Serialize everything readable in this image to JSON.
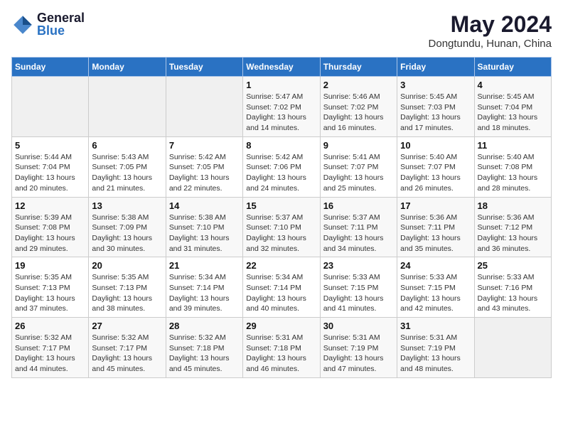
{
  "header": {
    "logo_line1": "General",
    "logo_line2": "Blue",
    "title": "May 2024",
    "subtitle": "Dongtundu, Hunan, China"
  },
  "weekdays": [
    "Sunday",
    "Monday",
    "Tuesday",
    "Wednesday",
    "Thursday",
    "Friday",
    "Saturday"
  ],
  "weeks": [
    [
      {
        "day": "",
        "info": ""
      },
      {
        "day": "",
        "info": ""
      },
      {
        "day": "",
        "info": ""
      },
      {
        "day": "1",
        "info": "Sunrise: 5:47 AM\nSunset: 7:02 PM\nDaylight: 13 hours\nand 14 minutes."
      },
      {
        "day": "2",
        "info": "Sunrise: 5:46 AM\nSunset: 7:02 PM\nDaylight: 13 hours\nand 16 minutes."
      },
      {
        "day": "3",
        "info": "Sunrise: 5:45 AM\nSunset: 7:03 PM\nDaylight: 13 hours\nand 17 minutes."
      },
      {
        "day": "4",
        "info": "Sunrise: 5:45 AM\nSunset: 7:04 PM\nDaylight: 13 hours\nand 18 minutes."
      }
    ],
    [
      {
        "day": "5",
        "info": "Sunrise: 5:44 AM\nSunset: 7:04 PM\nDaylight: 13 hours\nand 20 minutes."
      },
      {
        "day": "6",
        "info": "Sunrise: 5:43 AM\nSunset: 7:05 PM\nDaylight: 13 hours\nand 21 minutes."
      },
      {
        "day": "7",
        "info": "Sunrise: 5:42 AM\nSunset: 7:05 PM\nDaylight: 13 hours\nand 22 minutes."
      },
      {
        "day": "8",
        "info": "Sunrise: 5:42 AM\nSunset: 7:06 PM\nDaylight: 13 hours\nand 24 minutes."
      },
      {
        "day": "9",
        "info": "Sunrise: 5:41 AM\nSunset: 7:07 PM\nDaylight: 13 hours\nand 25 minutes."
      },
      {
        "day": "10",
        "info": "Sunrise: 5:40 AM\nSunset: 7:07 PM\nDaylight: 13 hours\nand 26 minutes."
      },
      {
        "day": "11",
        "info": "Sunrise: 5:40 AM\nSunset: 7:08 PM\nDaylight: 13 hours\nand 28 minutes."
      }
    ],
    [
      {
        "day": "12",
        "info": "Sunrise: 5:39 AM\nSunset: 7:08 PM\nDaylight: 13 hours\nand 29 minutes."
      },
      {
        "day": "13",
        "info": "Sunrise: 5:38 AM\nSunset: 7:09 PM\nDaylight: 13 hours\nand 30 minutes."
      },
      {
        "day": "14",
        "info": "Sunrise: 5:38 AM\nSunset: 7:10 PM\nDaylight: 13 hours\nand 31 minutes."
      },
      {
        "day": "15",
        "info": "Sunrise: 5:37 AM\nSunset: 7:10 PM\nDaylight: 13 hours\nand 32 minutes."
      },
      {
        "day": "16",
        "info": "Sunrise: 5:37 AM\nSunset: 7:11 PM\nDaylight: 13 hours\nand 34 minutes."
      },
      {
        "day": "17",
        "info": "Sunrise: 5:36 AM\nSunset: 7:11 PM\nDaylight: 13 hours\nand 35 minutes."
      },
      {
        "day": "18",
        "info": "Sunrise: 5:36 AM\nSunset: 7:12 PM\nDaylight: 13 hours\nand 36 minutes."
      }
    ],
    [
      {
        "day": "19",
        "info": "Sunrise: 5:35 AM\nSunset: 7:13 PM\nDaylight: 13 hours\nand 37 minutes."
      },
      {
        "day": "20",
        "info": "Sunrise: 5:35 AM\nSunset: 7:13 PM\nDaylight: 13 hours\nand 38 minutes."
      },
      {
        "day": "21",
        "info": "Sunrise: 5:34 AM\nSunset: 7:14 PM\nDaylight: 13 hours\nand 39 minutes."
      },
      {
        "day": "22",
        "info": "Sunrise: 5:34 AM\nSunset: 7:14 PM\nDaylight: 13 hours\nand 40 minutes."
      },
      {
        "day": "23",
        "info": "Sunrise: 5:33 AM\nSunset: 7:15 PM\nDaylight: 13 hours\nand 41 minutes."
      },
      {
        "day": "24",
        "info": "Sunrise: 5:33 AM\nSunset: 7:15 PM\nDaylight: 13 hours\nand 42 minutes."
      },
      {
        "day": "25",
        "info": "Sunrise: 5:33 AM\nSunset: 7:16 PM\nDaylight: 13 hours\nand 43 minutes."
      }
    ],
    [
      {
        "day": "26",
        "info": "Sunrise: 5:32 AM\nSunset: 7:17 PM\nDaylight: 13 hours\nand 44 minutes."
      },
      {
        "day": "27",
        "info": "Sunrise: 5:32 AM\nSunset: 7:17 PM\nDaylight: 13 hours\nand 45 minutes."
      },
      {
        "day": "28",
        "info": "Sunrise: 5:32 AM\nSunset: 7:18 PM\nDaylight: 13 hours\nand 45 minutes."
      },
      {
        "day": "29",
        "info": "Sunrise: 5:31 AM\nSunset: 7:18 PM\nDaylight: 13 hours\nand 46 minutes."
      },
      {
        "day": "30",
        "info": "Sunrise: 5:31 AM\nSunset: 7:19 PM\nDaylight: 13 hours\nand 47 minutes."
      },
      {
        "day": "31",
        "info": "Sunrise: 5:31 AM\nSunset: 7:19 PM\nDaylight: 13 hours\nand 48 minutes."
      },
      {
        "day": "",
        "info": ""
      }
    ]
  ]
}
